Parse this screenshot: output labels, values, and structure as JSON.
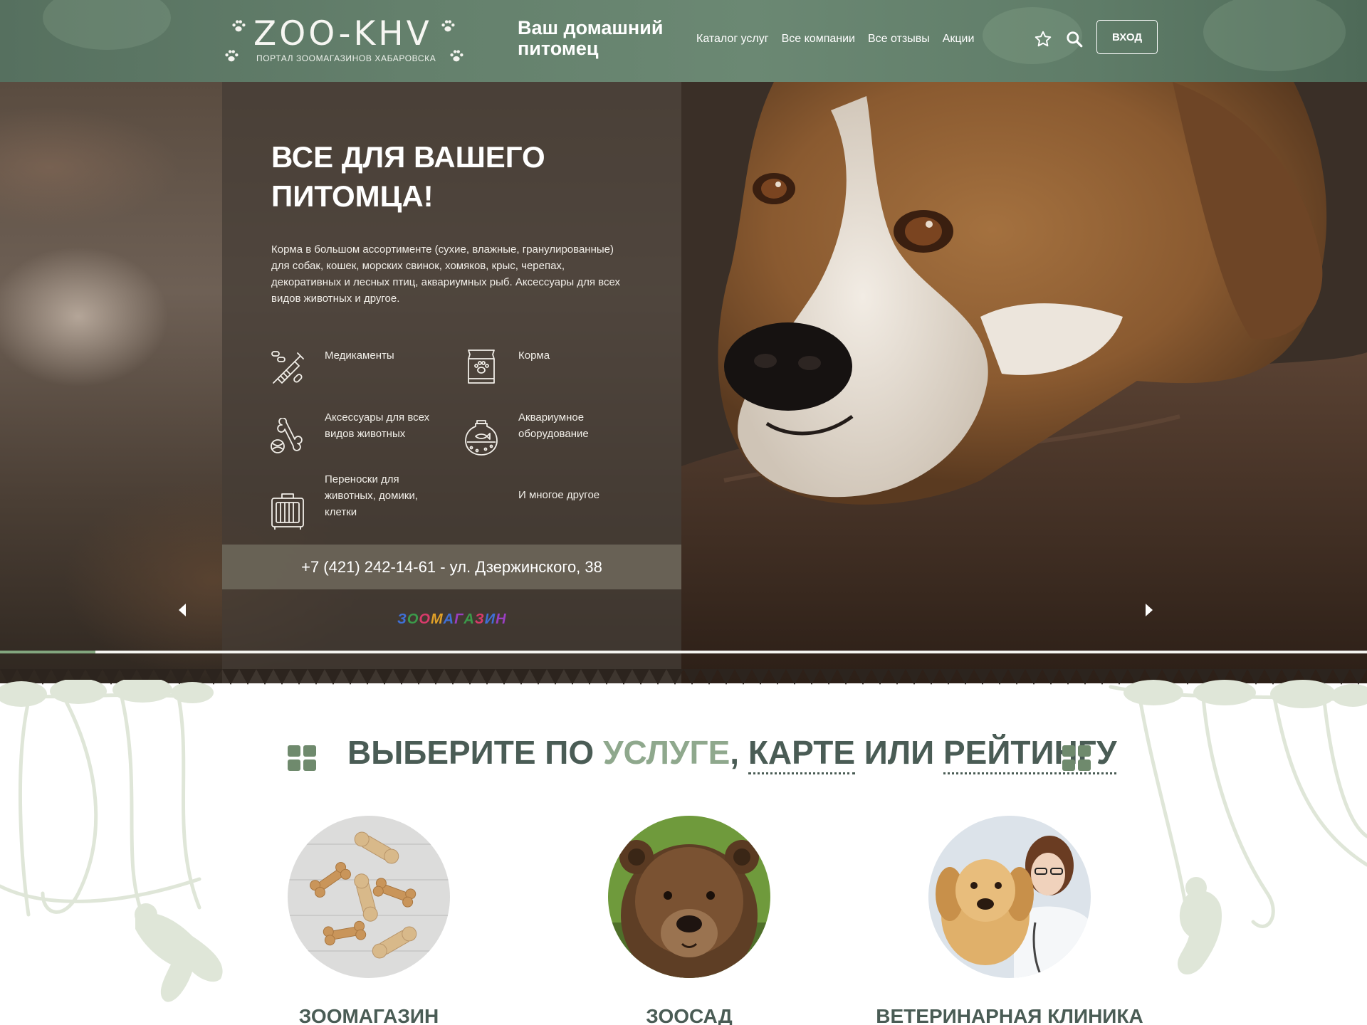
{
  "header": {
    "logo_text": "ZOO-KHV",
    "logo_subtitle": "ПОРТАЛ ЗООМАГАЗИНОВ ХАБАРОВСКА",
    "tagline": "Ваш домашний питомец",
    "nav": [
      {
        "label": "Каталог услуг"
      },
      {
        "label": "Все компании"
      },
      {
        "label": "Все отзывы"
      },
      {
        "label": "Акции"
      }
    ],
    "favorites_icon": "star-icon",
    "search_icon": "search-icon",
    "login_label": "ВХОД"
  },
  "hero": {
    "title_line1": "ВСЕ ДЛЯ ВАШЕГО",
    "title_line2": "ПИТОМЦА!",
    "description": "Корма в большом ассортименте (сухие, влажные, гранулированные) для собак, кошек, морских свинок, хомяков, крыс, черепах, декоративных и лесных птиц, аквариумных рыб. Аксессуары для всех видов животных и другое.",
    "features": [
      {
        "label": "Медикаменты",
        "icon": "medicine-icon"
      },
      {
        "label": "Корма",
        "icon": "food-bag-icon"
      },
      {
        "label": "Аксессуары для всех видов животных",
        "icon": "bone-ball-icon"
      },
      {
        "label": "Аквариумное оборудование",
        "icon": "aquarium-icon"
      },
      {
        "label": "Переноски для животных, домики, клетки",
        "icon": "pet-carrier-icon"
      },
      {
        "label": "И многое другое",
        "icon": ""
      }
    ],
    "contact": "+7 (421) 242-14-61 - ул. Дзержинского, 38",
    "brand": "ЗООМАГАЗИН",
    "slider_progress": 0.07
  },
  "section": {
    "title_part1": "ВЫБЕРИТЕ ПО ",
    "title_highlight": "УСЛУГЕ",
    "title_sep": ", ",
    "title_map": "КАРТЕ",
    "title_or": " ИЛИ ",
    "title_rating": "РЕЙТИНГУ",
    "cards": [
      {
        "label": "ЗООМАГАЗИН",
        "image": "dog-treats"
      },
      {
        "label": "ЗООСАД",
        "image": "bear"
      },
      {
        "label": "ВЕТЕРИНАРНАЯ КЛИНИКА",
        "image": "vet-with-puppy"
      }
    ]
  },
  "colors": {
    "header_green": "#64806c",
    "title_dark": "#4a5c55",
    "title_highlight": "#8fa88d",
    "jungle_pale": "#dfe6d8"
  }
}
